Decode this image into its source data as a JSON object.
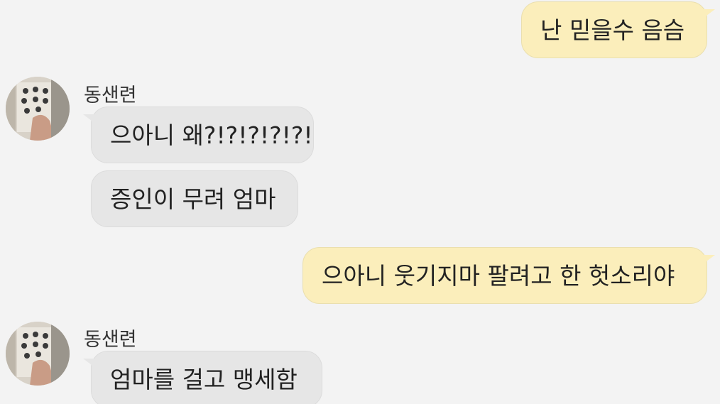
{
  "messages": [
    {
      "side": "me",
      "text": "난 믿을수 음슴"
    },
    {
      "side": "them",
      "sender": "동샌련",
      "texts": [
        "으아니 왜?!?!?!?!?!",
        "증인이 무려 엄마"
      ]
    },
    {
      "side": "me",
      "text": "으아니 웃기지마 팔려고 한 헛소리야"
    },
    {
      "side": "them",
      "sender": "동샌련",
      "texts": [
        "엄마를 걸고 맹세함"
      ]
    }
  ],
  "colors": {
    "background": "#f3f3f3",
    "my_bubble": "#fbeebb",
    "their_bubble": "#e6e6e6"
  },
  "icons": {
    "avatar": "profile-photo-avatar"
  }
}
